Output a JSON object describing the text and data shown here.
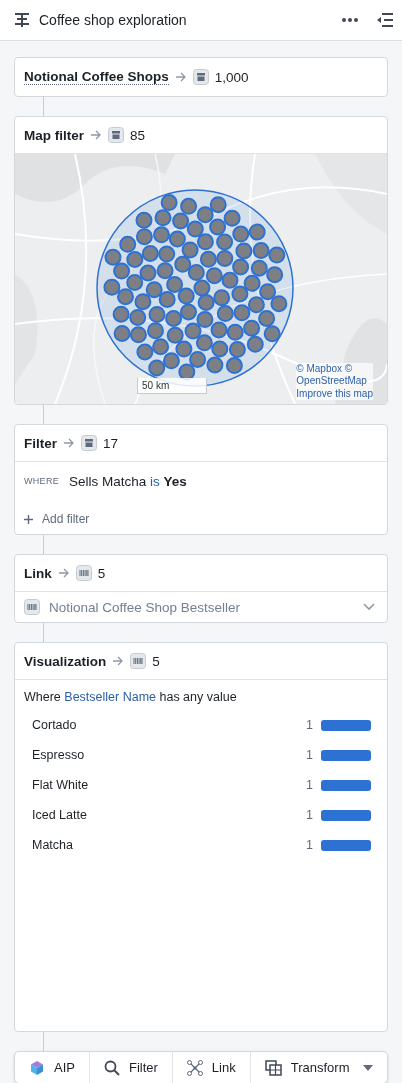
{
  "header": {
    "title": "Coffee shop exploration"
  },
  "source": {
    "title": "Notional Coffee Shops",
    "count": "1,000",
    "kind": "store"
  },
  "map_filter": {
    "title": "Map filter",
    "count": "85",
    "kind": "store",
    "scale": "50 km",
    "attribution": [
      "© Mapbox ©",
      "OpenStreetMap",
      "Improve this map"
    ]
  },
  "filter": {
    "title": "Filter",
    "count": "17",
    "kind": "store",
    "where_label": "WHERE",
    "property": "Sells Matcha",
    "operator": "is",
    "value": "Yes",
    "add_filter": "Add filter"
  },
  "link": {
    "title": "Link",
    "count": "5",
    "kind": "barcode",
    "object_type": "Notional Coffee Shop Bestseller"
  },
  "visualization": {
    "title": "Visualization",
    "count": "5",
    "kind": "barcode",
    "caption_prefix": "Where",
    "property": "Bestseller Name",
    "caption_suffix": "has any value",
    "rows": [
      {
        "label": "Cortado",
        "value": "1",
        "level": 1
      },
      {
        "label": "Espresso",
        "value": "1",
        "level": 1
      },
      {
        "label": "Flat White",
        "value": "1",
        "level": 1
      },
      {
        "label": "Iced Latte",
        "value": "1",
        "level": 1
      },
      {
        "label": "Matcha",
        "value": "1",
        "level": 1
      }
    ]
  },
  "toolbar": [
    {
      "label": "AIP",
      "kind": "aip"
    },
    {
      "label": "Filter",
      "kind": "search"
    },
    {
      "label": "Link",
      "kind": "link"
    },
    {
      "label": "Transform",
      "kind": "transform",
      "dropdown": true
    }
  ]
}
